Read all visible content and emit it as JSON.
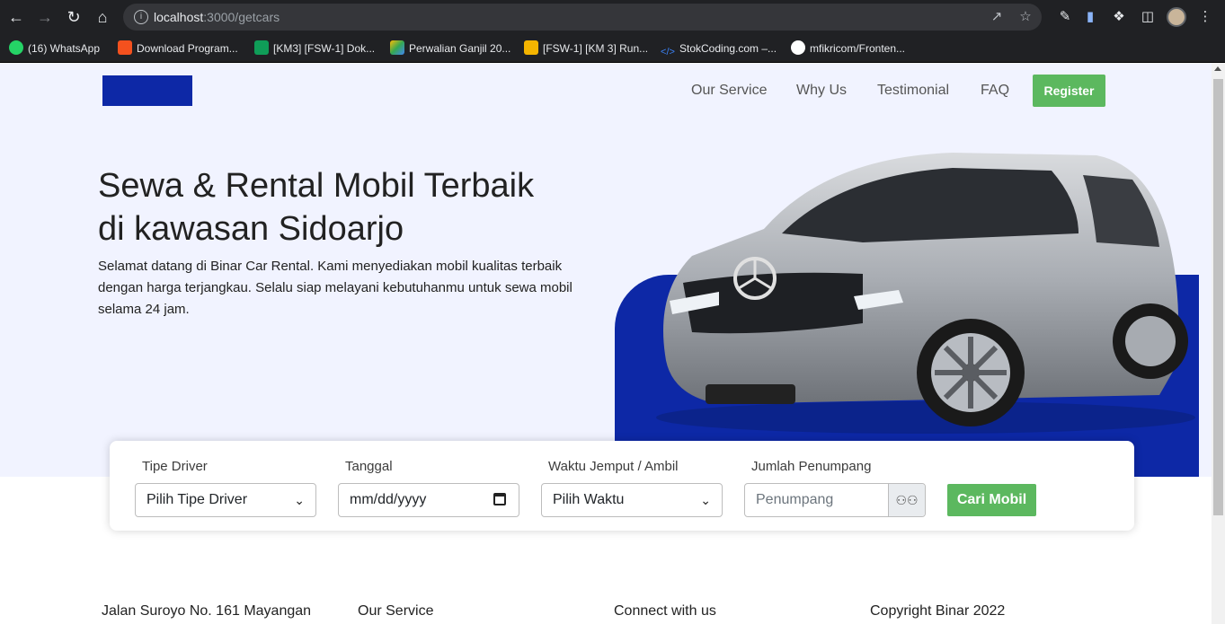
{
  "browser": {
    "url_host": "localhost",
    "url_path": ":3000/getcars",
    "bookmarks": [
      {
        "label": "(16) WhatsApp",
        "color": "#25d366"
      },
      {
        "label": "Download Program...",
        "color": "#f4511e"
      },
      {
        "label": "[KM3] [FSW-1] Dok...",
        "color": "#0f9d58"
      },
      {
        "label": "Perwalian Ganjil 20...",
        "color": "#fbbc04"
      },
      {
        "label": "[FSW-1] [KM 3] Run...",
        "color": "#f4b400"
      },
      {
        "label": "StokCoding.com –...",
        "color": "#3b82f6"
      },
      {
        "label": "mfikricom/Fronten...",
        "color": "#ffffff"
      }
    ]
  },
  "nav": {
    "items": [
      "Our Service",
      "Why Us",
      "Testimonial",
      "FAQ"
    ],
    "register_label": "Register"
  },
  "hero": {
    "title_line1": "Sewa & Rental Mobil Terbaik",
    "title_line2": "di kawasan Sidoarjo",
    "description": "Selamat datang di Binar Car Rental. Kami menyediakan mobil kualitas terbaik dengan harga terjangkau. Selalu siap melayani kebutuhanmu untuk sewa mobil selama 24 jam."
  },
  "search": {
    "driver_label": "Tipe Driver",
    "driver_value": "Pilih Tipe Driver",
    "date_label": "Tanggal",
    "date_value": "mm/dd/yyyy",
    "time_label": "Waktu Jemput / Ambil",
    "time_value": "Pilih Waktu",
    "passenger_label": "Jumlah Penumpang",
    "passenger_placeholder": "Penumpang",
    "submit_label": "Cari Mobil"
  },
  "footer": {
    "address": "Jalan Suroyo No. 161 Mayangan",
    "service": "Our Service",
    "connect": "Connect with us",
    "copyright": "Copyright Binar 2022"
  },
  "colors": {
    "brand_blue": "#0d28a6",
    "accent_green": "#5cb85f",
    "hero_bg": "#f1f3ff"
  }
}
